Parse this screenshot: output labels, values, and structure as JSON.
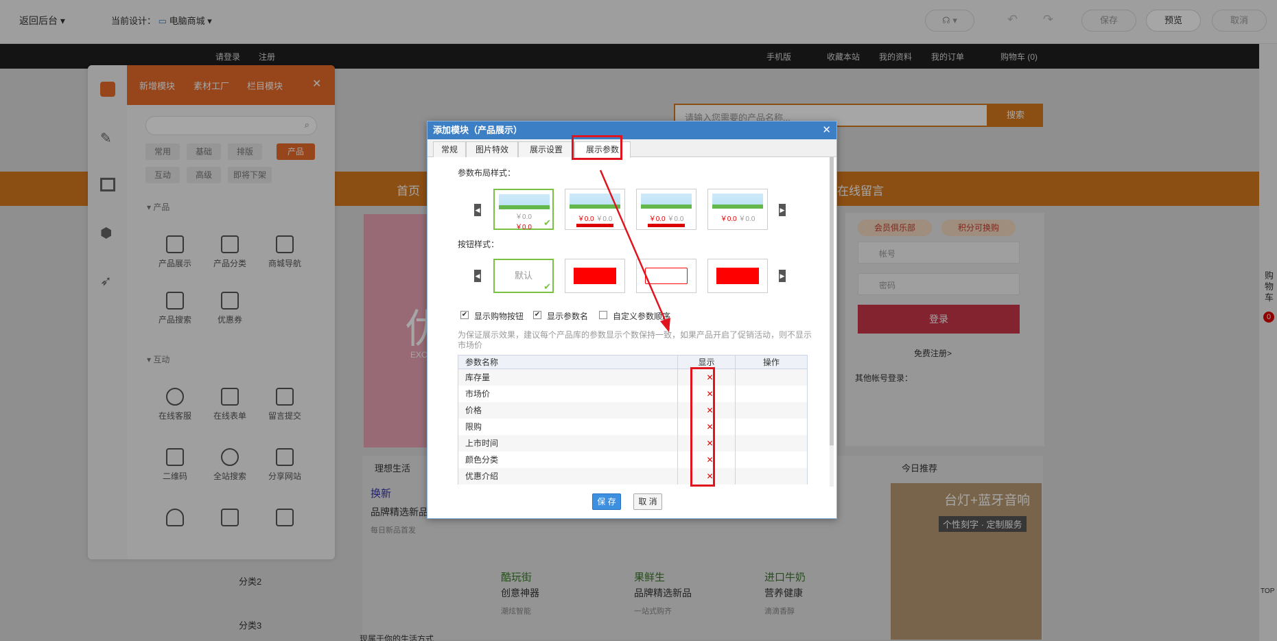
{
  "topbar": {
    "back": "返回后台",
    "design_label": "当前设计：",
    "design_value": "电脑商城",
    "save": "保存",
    "preview": "预览",
    "cancel": "取消"
  },
  "site": {
    "nav_left": [
      "请登录",
      "注册"
    ],
    "nav_right": [
      "手机版",
      "收藏本站",
      "我的资料",
      "我的订单",
      "购物车 (0)"
    ],
    "search_placeholder": "请输入您需要的产品名称...",
    "search_btn": "搜索",
    "menu": [
      "首页",
      "在线留言"
    ],
    "member_club": "会员俱乐部",
    "points": "积分可换购",
    "account": "帐号",
    "password": "密码",
    "login": "登录",
    "register": "免费注册>",
    "other_login": "其他帐号登录：",
    "banner_big": "优",
    "banner_small": "EXC",
    "sec_left": "理想生活",
    "sec_right": "今日推荐",
    "promo1_title": "换新",
    "promo1_sub": "品牌精选新品",
    "promo1_note": "每日新品首发",
    "promos": [
      {
        "t": "酷玩街",
        "s": "创意神器",
        "n": "潮炫智能"
      },
      {
        "t": "果鲜生",
        "s": "品牌精选新品",
        "n": "一站式购齐"
      },
      {
        "t": "进口牛奶",
        "s": "营养健康",
        "n": "滴滴香醇"
      }
    ],
    "recommend_title": "台灯+蓝牙音响",
    "recommend_sub": "个性刻字 · 定制服务",
    "cats": [
      "分类2",
      "分类3"
    ],
    "bottom_text": "现属于你的生活方式",
    "right_cart": "购物车",
    "right_count": "0",
    "top_label": "TOP"
  },
  "panel": {
    "tabs": [
      "新增模块",
      "素材工厂",
      "栏目模块"
    ],
    "filters": [
      "常用",
      "基础",
      "排版",
      "产品",
      "互动",
      "高级",
      "即将下架"
    ],
    "group1": "产品",
    "group1_items": [
      "产品展示",
      "产品分类",
      "商城导航",
      "产品搜索",
      "优惠券"
    ],
    "group2": "互动",
    "group2_items": [
      "在线客服",
      "在线表单",
      "留言提交",
      "二维码",
      "全站搜索",
      "分享网站"
    ]
  },
  "dialog": {
    "title": "添加模块（产品展示）",
    "tabs": [
      "常规",
      "图片特效",
      "展示设置",
      "展示参数"
    ],
    "layout_label": "参数布局样式：",
    "button_label": "按钮样式：",
    "default_btn": "默认",
    "price": "￥0.0",
    "old_price": "￥0.0",
    "checks": [
      "显示购物按钮",
      "显示参数名",
      "自定义参数顺序"
    ],
    "note": "为保证展示效果，建议每个产品库的参数显示个数保持一致，如果产品开启了促销活动，则不显示市场价",
    "headers": [
      "参数名称",
      "显示",
      "操作"
    ],
    "rows": [
      "库存量",
      "市场价",
      "价格",
      "限购",
      "上市时间",
      "颜色分类",
      "优惠介绍"
    ],
    "x_mark": "✕",
    "save": "保 存",
    "cancel": "取 消",
    "accent": "#3d7fc4",
    "highlight": "#e0141e"
  }
}
